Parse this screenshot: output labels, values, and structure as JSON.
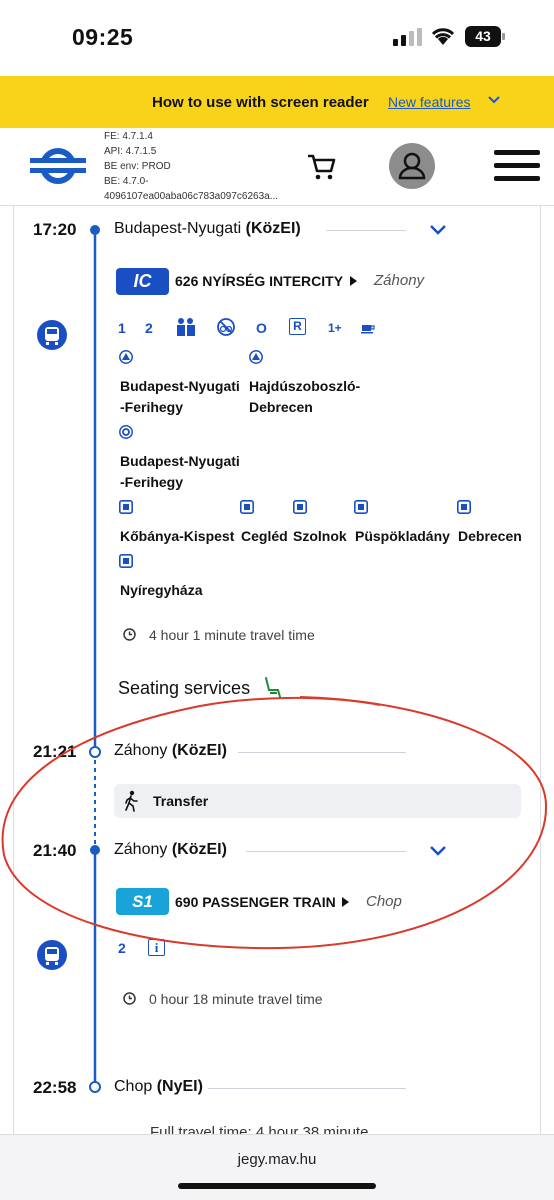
{
  "status_bar": {
    "time": "09:25",
    "battery": "43"
  },
  "banner": {
    "text": "How to use with screen reader",
    "link": "New features"
  },
  "header": {
    "version_lines": [
      "FE: 4.7.1.4",
      "API: 4.7.1.5",
      "BE env: PROD",
      "BE: 4.7.0-",
      "4096107ea00aba06c783a097c6263a..."
    ]
  },
  "journey": {
    "leg1": {
      "dep_time": "17:20",
      "dep_station_name": "Budapest-Nyugati",
      "dep_station_suffix": "(KözEI)",
      "train_badge": "IC",
      "train_name": "626 NYÍRSÉG INTERCITY",
      "direction": "Záhony",
      "services": [
        "1",
        "2",
        "O",
        "R",
        "1+"
      ],
      "stop_group_a": [
        "Budapest-Nyugati\n-Ferihegy",
        "Hajdúszoboszló-\nDebrecen"
      ],
      "stop_group_b": [
        "Budapest-Nyugati\n-Ferihegy"
      ],
      "stop_group_c": [
        "Kőbánya-Kispest",
        "Cegléd",
        "Szolnok",
        "Püspökladány",
        "Debrecen",
        "Nyíregyháza"
      ],
      "travel_time": "4 hour 1 minute  travel time",
      "seating": "Seating services"
    },
    "arr1": {
      "time": "21:21",
      "station_name": "Záhony",
      "station_suffix": "(KözEI)"
    },
    "transfer": "Transfer",
    "leg2": {
      "dep_time": "21:40",
      "dep_station_name": "Záhony",
      "dep_station_suffix": "(KözEI)",
      "train_badge": "S1",
      "train_name": "690 PASSENGER TRAIN",
      "direction": "Chop",
      "services": [
        "2"
      ],
      "travel_time": "0 hour 18 minute  travel time"
    },
    "arr2": {
      "time": "22:58",
      "station_name": "Chop",
      "station_suffix": "(NyEI)"
    },
    "full_travel": "Full travel time:  4 hour 38 minute"
  },
  "url_bar": {
    "url": "jegy.mav.hu"
  },
  "colors": {
    "accent": "#1a5bc4",
    "banner": "#f9d21a",
    "annotation": "#d93a2b"
  }
}
